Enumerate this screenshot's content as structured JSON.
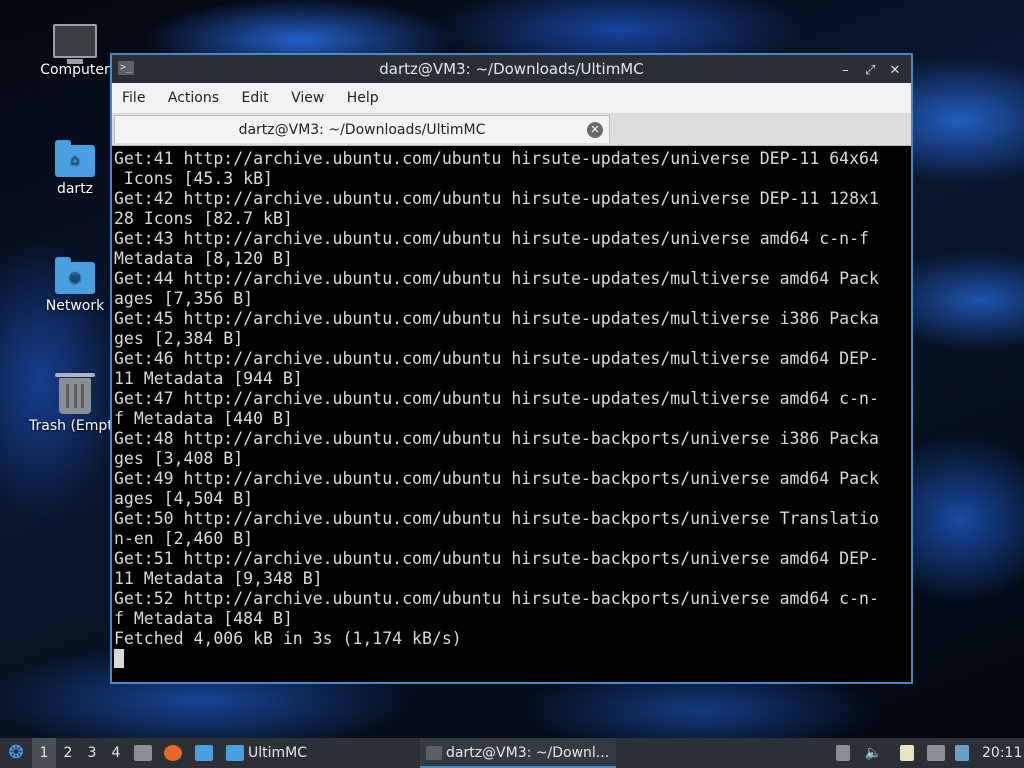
{
  "desktop": {
    "icons": [
      {
        "label": "Computer"
      },
      {
        "label": "dartz"
      },
      {
        "label": "Network"
      },
      {
        "label": "Trash (Empt"
      }
    ]
  },
  "window": {
    "title": "dartz@VM3: ~/Downloads/UltimMC",
    "app_icon_glyph": ">_",
    "controls": {
      "minimize": "–",
      "maximize": "⤢",
      "close": "✕"
    },
    "menu": [
      "File",
      "Actions",
      "Edit",
      "View",
      "Help"
    ],
    "tab_label": "dartz@VM3: ~/Downloads/UltimMC",
    "terminal_lines": [
      "Get:41 http://archive.ubuntu.com/ubuntu hirsute-updates/universe DEP-11 64x64",
      " Icons [45.3 kB]",
      "Get:42 http://archive.ubuntu.com/ubuntu hirsute-updates/universe DEP-11 128x1",
      "28 Icons [82.7 kB]",
      "Get:43 http://archive.ubuntu.com/ubuntu hirsute-updates/universe amd64 c-n-f",
      "Metadata [8,120 B]",
      "Get:44 http://archive.ubuntu.com/ubuntu hirsute-updates/multiverse amd64 Pack",
      "ages [7,356 B]",
      "Get:45 http://archive.ubuntu.com/ubuntu hirsute-updates/multiverse i386 Packa",
      "ges [2,384 B]",
      "Get:46 http://archive.ubuntu.com/ubuntu hirsute-updates/multiverse amd64 DEP-",
      "11 Metadata [944 B]",
      "Get:47 http://archive.ubuntu.com/ubuntu hirsute-updates/multiverse amd64 c-n-",
      "f Metadata [440 B]",
      "Get:48 http://archive.ubuntu.com/ubuntu hirsute-backports/universe i386 Packa",
      "ges [3,408 B]",
      "Get:49 http://archive.ubuntu.com/ubuntu hirsute-backports/universe amd64 Pack",
      "ages [4,504 B]",
      "Get:50 http://archive.ubuntu.com/ubuntu hirsute-backports/universe Translatio",
      "n-en [2,460 B]",
      "Get:51 http://archive.ubuntu.com/ubuntu hirsute-backports/universe amd64 DEP-",
      "11 Metadata [9,348 B]",
      "Get:52 http://archive.ubuntu.com/ubuntu hirsute-backports/universe amd64 c-n-",
      "f Metadata [484 B]",
      "Fetched 4,006 kB in 3s (1,174 kB/s)"
    ]
  },
  "taskbar": {
    "workspaces": [
      "1",
      "2",
      "3",
      "4"
    ],
    "active_workspace": "1",
    "folder_task_label": "UltimMC",
    "terminal_task_label": "dartz@VM3: ~/Downl...",
    "clock": "20:11",
    "colors": {
      "accent": "#4a88c8",
      "panel": "#2c3036"
    }
  }
}
